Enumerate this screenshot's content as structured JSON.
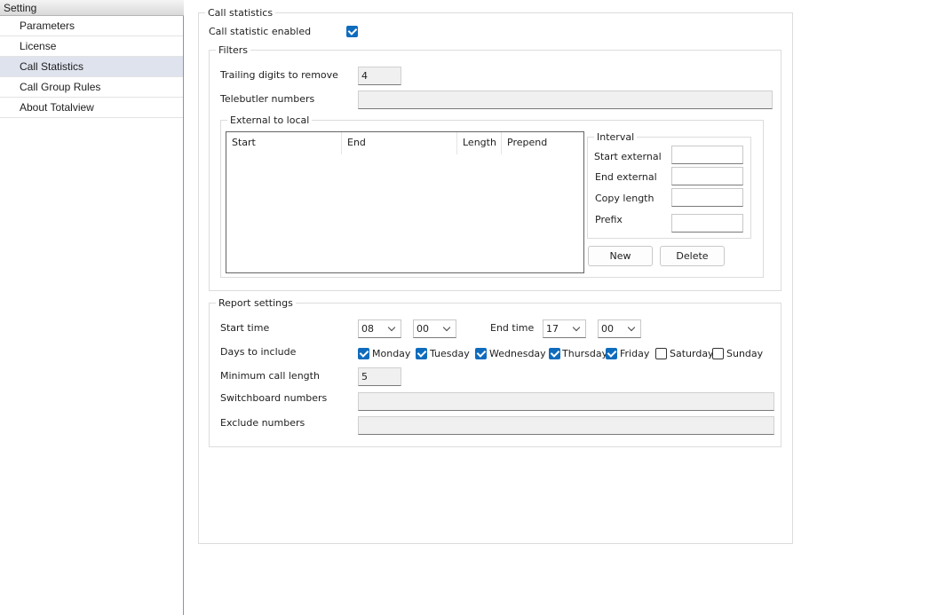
{
  "sidebar": {
    "header": "Setting",
    "items": [
      {
        "label": "Parameters"
      },
      {
        "label": "License"
      },
      {
        "label": "Call Statistics"
      },
      {
        "label": "Call Group Rules"
      },
      {
        "label": "About Totalview"
      }
    ],
    "selected_index": 2
  },
  "call_statistics": {
    "title": "Call statistics",
    "enabled_label": "Call statistic enabled",
    "enabled": true
  },
  "filters": {
    "title": "Filters",
    "trailing_label": "Trailing digits to remove",
    "trailing_value": "4",
    "telebutler_label": "Telebutler numbers",
    "telebutler_value": "",
    "ext_to_local": {
      "title": "External to local",
      "columns": [
        "Start",
        "End",
        "Length",
        "Prepend"
      ],
      "rows": []
    },
    "interval": {
      "title": "Interval",
      "start_external_label": "Start external",
      "start_external_value": "",
      "end_external_label": "End external",
      "end_external_value": "",
      "copy_length_label": "Copy length",
      "copy_length_value": "",
      "prefix_label": "Prefix",
      "prefix_value": ""
    },
    "new_label": "New",
    "delete_label": "Delete"
  },
  "report": {
    "title": "Report settings",
    "start_time_label": "Start time",
    "start_hour": "08",
    "start_minute": "00",
    "end_time_label": "End time",
    "end_hour": "17",
    "end_minute": "00",
    "days_label": "Days to include",
    "days": [
      {
        "label": "Monday",
        "checked": true
      },
      {
        "label": "Tuesday",
        "checked": true
      },
      {
        "label": "Wednesday",
        "checked": true
      },
      {
        "label": "Thursday",
        "checked": true
      },
      {
        "label": "Friday",
        "checked": true
      },
      {
        "label": "Saturday",
        "checked": false
      },
      {
        "label": "Sunday",
        "checked": false
      }
    ],
    "min_call_label": "Minimum call length",
    "min_call_value": "5",
    "switchboard_label": "Switchboard numbers",
    "switchboard_value": "",
    "exclude_label": "Exclude numbers",
    "exclude_value": ""
  }
}
